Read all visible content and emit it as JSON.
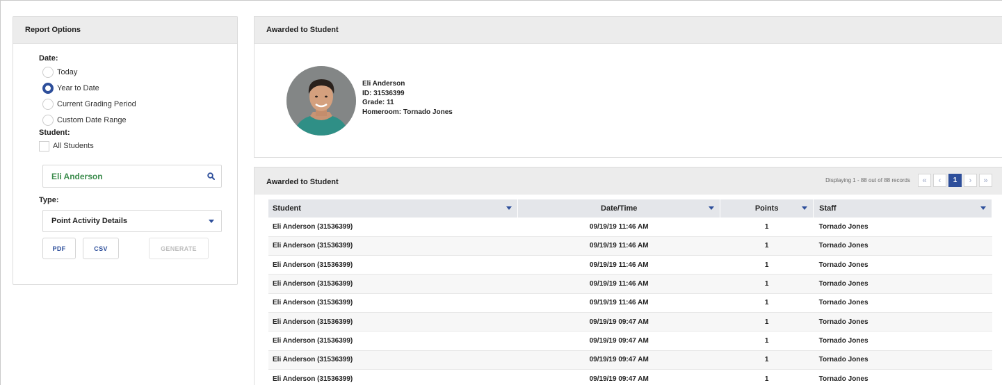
{
  "report_options": {
    "title": "Report Options",
    "date_label": "Date:",
    "date_options": [
      {
        "label": "Today",
        "selected": false
      },
      {
        "label": "Year to Date",
        "selected": true
      },
      {
        "label": "Current Grading Period",
        "selected": false
      },
      {
        "label": "Custom Date Range",
        "selected": false
      }
    ],
    "student_label": "Student:",
    "all_students_label": "All Students",
    "search_value": "Eli Anderson",
    "type_label": "Type:",
    "type_value": "Point Activity Details",
    "pdf_label": "PDF",
    "csv_label": "CSV",
    "generate_label": "GENERATE"
  },
  "student_card": {
    "title": "Awarded to Student",
    "name": "Eli Anderson",
    "id_line": "ID: 31536399",
    "grade_line": "Grade: 11",
    "homeroom_line": "Homeroom: Tornado Jones"
  },
  "records": {
    "title": "Awarded to Student",
    "displaying": "Displaying 1 - 88 out of 88 records",
    "current_page": "1",
    "columns": [
      "Student",
      "Date/Time",
      "Points",
      "Staff"
    ],
    "rows": [
      [
        "Eli Anderson (31536399)",
        "09/19/19 11:46 AM",
        "1",
        "Tornado Jones"
      ],
      [
        "Eli Anderson (31536399)",
        "09/19/19 11:46 AM",
        "1",
        "Tornado Jones"
      ],
      [
        "Eli Anderson (31536399)",
        "09/19/19 11:46 AM",
        "1",
        "Tornado Jones"
      ],
      [
        "Eli Anderson (31536399)",
        "09/19/19 11:46 AM",
        "1",
        "Tornado Jones"
      ],
      [
        "Eli Anderson (31536399)",
        "09/19/19 11:46 AM",
        "1",
        "Tornado Jones"
      ],
      [
        "Eli Anderson (31536399)",
        "09/19/19 09:47 AM",
        "1",
        "Tornado Jones"
      ],
      [
        "Eli Anderson (31536399)",
        "09/19/19 09:47 AM",
        "1",
        "Tornado Jones"
      ],
      [
        "Eli Anderson (31536399)",
        "09/19/19 09:47 AM",
        "1",
        "Tornado Jones"
      ],
      [
        "Eli Anderson (31536399)",
        "09/19/19 09:47 AM",
        "1",
        "Tornado Jones"
      ]
    ]
  },
  "colors": {
    "accent": "#2e4f9b",
    "search_text": "#3d8d4e",
    "header_bg": "#ececec"
  }
}
